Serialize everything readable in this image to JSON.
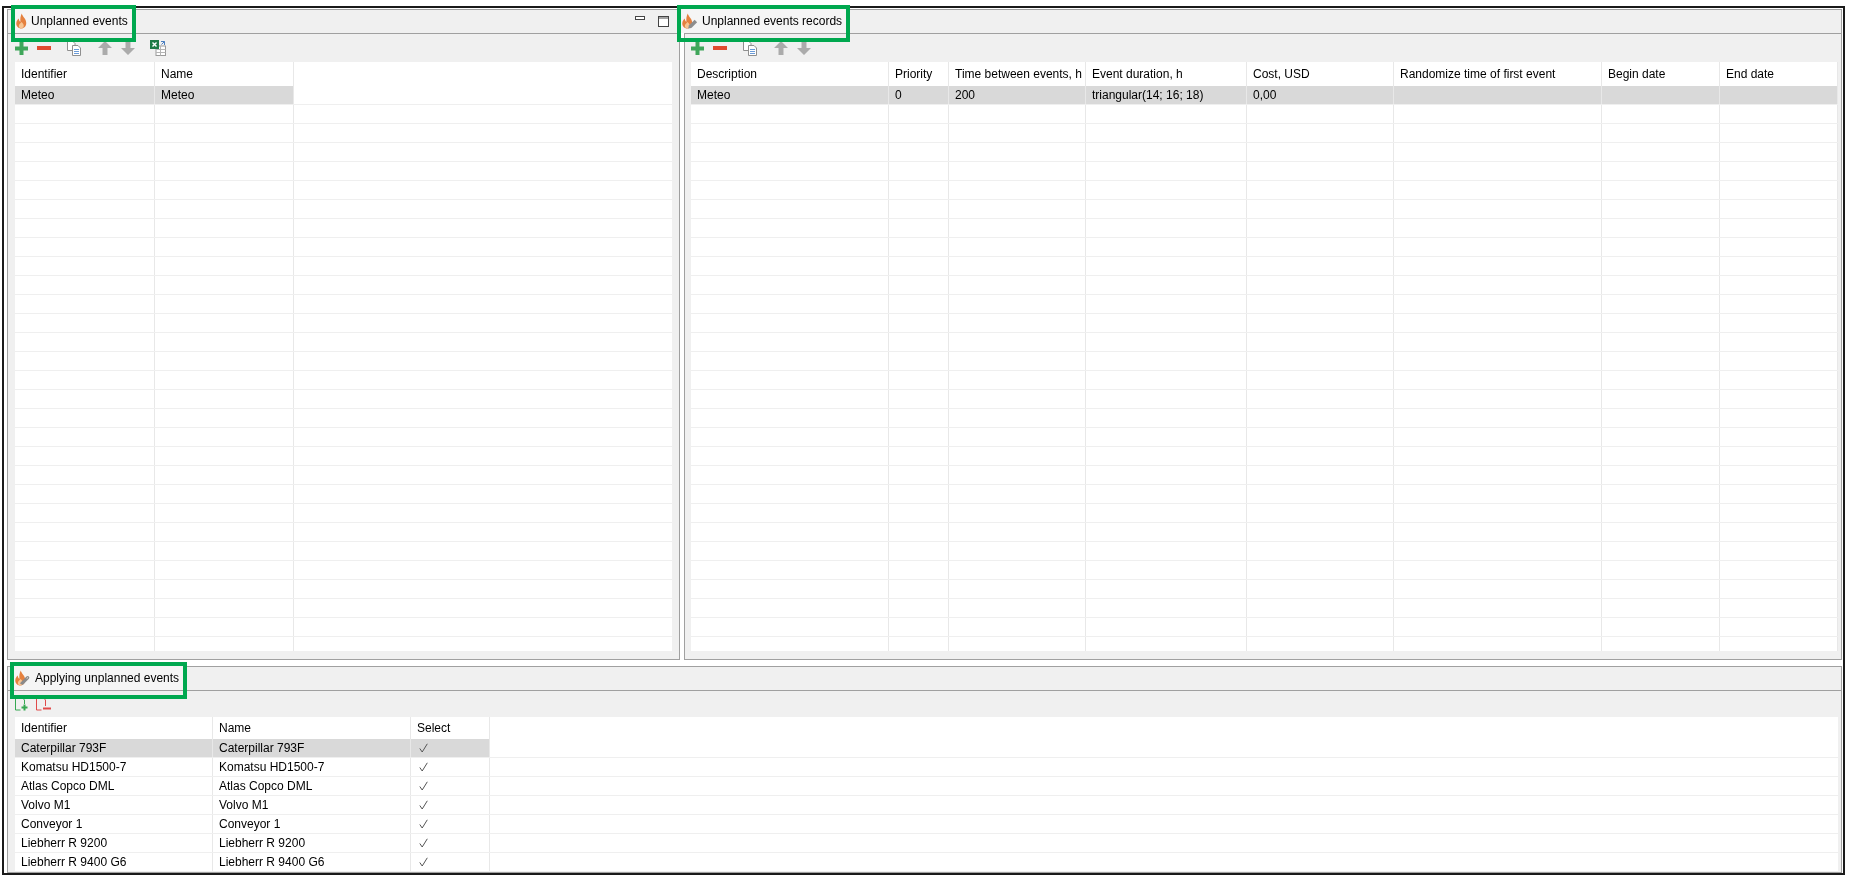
{
  "unplanned_events": {
    "tab": {
      "title": "Unplanned events",
      "highlighted": true
    },
    "toolbar": [
      {
        "kind": "add",
        "disabled": false
      },
      {
        "kind": "remove",
        "disabled": false
      },
      {
        "kind": "copy",
        "disabled": false
      },
      {
        "kind": "move_up",
        "disabled": true
      },
      {
        "kind": "move_down",
        "disabled": true
      },
      {
        "kind": "export_excel",
        "disabled": false
      }
    ],
    "table": {
      "columns": [
        "Identifier",
        "Name"
      ],
      "rows": [
        {
          "cells": [
            "Meteo",
            "Meteo"
          ],
          "selected": true
        }
      ]
    }
  },
  "unplanned_events_records": {
    "tab": {
      "title": "Unplanned events records",
      "highlighted": true
    },
    "toolbar": [
      {
        "kind": "add",
        "disabled": false
      },
      {
        "kind": "remove",
        "disabled": false
      },
      {
        "kind": "copy",
        "disabled": false
      },
      {
        "kind": "move_up",
        "disabled": true
      },
      {
        "kind": "move_down",
        "disabled": true
      }
    ],
    "table": {
      "columns": [
        "Description",
        "Priority",
        "Time between events, h",
        "Event duration, h",
        "Cost, USD",
        "Randomize time of first event",
        "Begin date",
        "End date"
      ],
      "rows": [
        {
          "cells": [
            "Meteo",
            "0",
            "200",
            "triangular(14; 16; 18)",
            "0,00"
          ],
          "selected": true
        }
      ]
    }
  },
  "applying_unplanned_events": {
    "tab": {
      "title": "Applying unplanned events",
      "highlighted": true
    },
    "toolbar": [
      {
        "kind": "add_document",
        "disabled": false
      },
      {
        "kind": "remove_document",
        "disabled": false
      }
    ],
    "table": {
      "columns": [
        "Identifier",
        "Name",
        "Select"
      ],
      "rows": [
        {
          "cells": [
            "Caterpillar 793F",
            "Caterpillar 793F"
          ],
          "checked": true,
          "selected": true
        },
        {
          "cells": [
            "Komatsu HD1500-7",
            "Komatsu HD1500-7"
          ],
          "checked": true,
          "selected": false
        },
        {
          "cells": [
            "Atlas Copco DML",
            "Atlas Copco DML"
          ],
          "checked": true,
          "selected": false
        },
        {
          "cells": [
            "Volvo M1",
            "Volvo M1"
          ],
          "checked": true,
          "selected": false
        },
        {
          "cells": [
            "Conveyor 1",
            "Conveyor 1"
          ],
          "checked": true,
          "selected": false
        },
        {
          "cells": [
            "Liebherr R 9200",
            "Liebherr R 9200"
          ],
          "checked": true,
          "selected": false
        },
        {
          "cells": [
            "Liebherr R 9400 G6",
            "Liebherr R 9400 G6"
          ],
          "checked": true,
          "selected": false
        }
      ]
    }
  }
}
